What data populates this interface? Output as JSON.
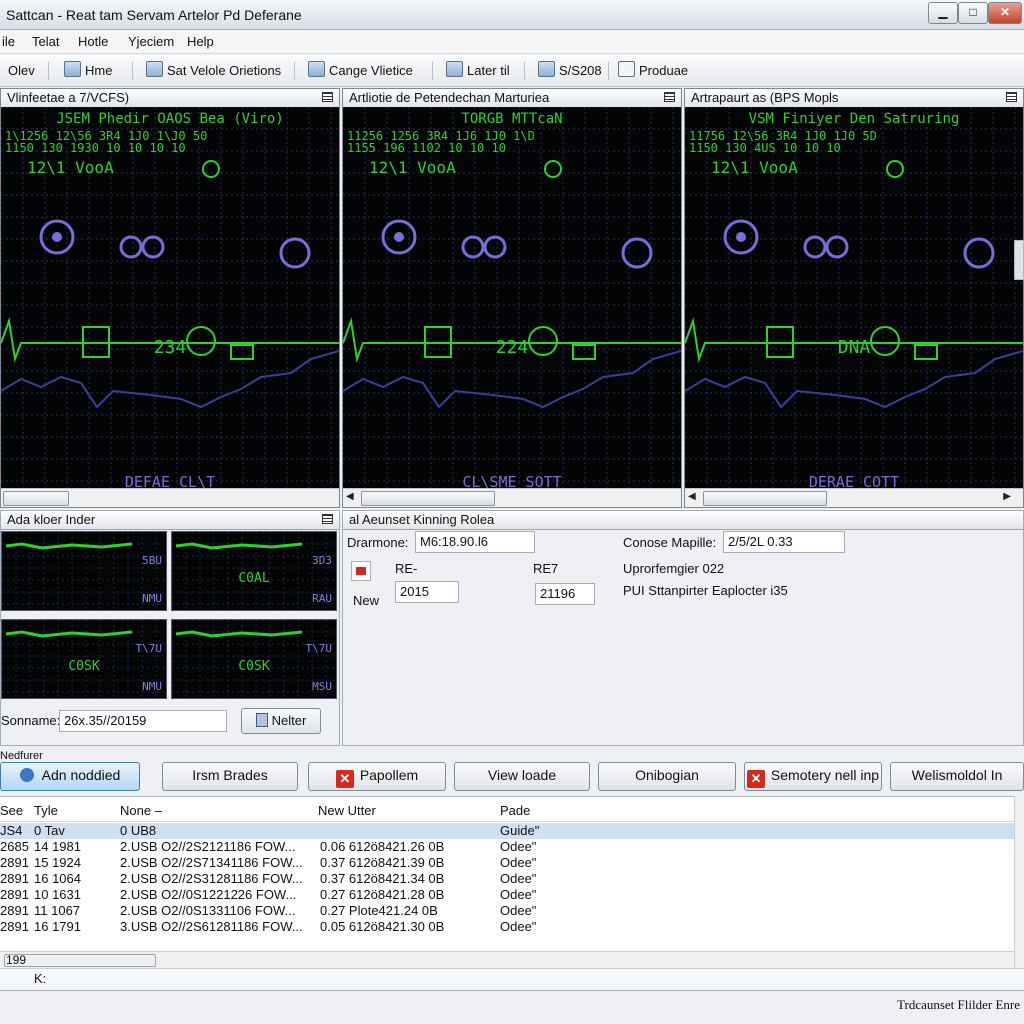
{
  "window": {
    "title": "Sattcan - Reat tam Servam Artelor Pd Deferane",
    "min": "▁",
    "max": "□",
    "close": "✕"
  },
  "menu": [
    "ile",
    "Telat",
    "Hotle",
    "Yjeciem",
    "Help"
  ],
  "toolbar": {
    "items": [
      "Olev",
      "Hme",
      "Sat Velole Orietions",
      "Cange Vlietice",
      "Later til",
      "S/S208",
      "Produae"
    ]
  },
  "panels": [
    {
      "title": "Vlinfeetae a 7/VCFS)",
      "scope_title": "JSEM Phedir OAOS Bea (Viro)",
      "ticks_top": "1\\1256  12\\56  3R4  1J0  1\\J0  50",
      "ticks_bottom": "1150  130  1930  10  10  10  10",
      "tag": "12\\1 VooA",
      "mid": "234",
      "foot": "DEFAE CL\\T"
    },
    {
      "title": "Artliotie de Petendechan Marturiea",
      "scope_title": "TORGB MTTcaN",
      "ticks_top": "11256  1256  3R4  1J6  1J0  1\\D",
      "ticks_bottom": "1155  196  1102  10  10  10",
      "tag": "12\\1 VooA",
      "mid": "224",
      "foot": "CL\\SME SOTT"
    },
    {
      "title": "Artrapaurt as (BPS Mopls",
      "scope_title": "VSM Finiyer Den Satruring",
      "ticks_top": "11756  12\\56  3R4  1J0  1J0  5D",
      "ticks_bottom": "1150  130  4US  10  10  10",
      "tag": "12\\1 VooA",
      "mid": "DNA",
      "foot": "DERAE COTT"
    }
  ],
  "lower_left": {
    "title": "Ada kloer Inder",
    "cells": [
      {
        "big": "",
        "small": [
          "5BU",
          "NMU"
        ]
      },
      {
        "big": "C0AL",
        "small": [
          "3D3",
          "RAU"
        ]
      },
      {
        "big": "C0SK",
        "small": [
          "T\\7U",
          "NMU"
        ]
      },
      {
        "big": "C0SK",
        "small": [
          "T\\7U",
          "MSU"
        ]
      }
    ],
    "sonname_label": "Sonname:",
    "sonname_value": "26x.35//20159",
    "button": "Nelter"
  },
  "lower_right": {
    "title": "al Aeunset Kinning Rolea",
    "dramone_label": "Drarmone:",
    "dramone_value": "M6:18.90.l6",
    "conose_label": "Conose Mapille:",
    "conose_value": "2/5/2L 0.33",
    "re_label": "RE-",
    "re7_label": "RE7",
    "new_label": "New",
    "new_value": "2015",
    "re7_value": "21196",
    "uprorr": "Uprorfemgier 022",
    "pui": "PUI Sttanpirter Eaplocter i35"
  },
  "section_label": "Nedfurer",
  "buttons": [
    "Adn noddied",
    "Irsm Brades",
    "Papollem",
    "View loade",
    "Onibogian",
    "Semotery nell inp",
    "Welismoldol In"
  ],
  "table": {
    "headers": [
      "See",
      "Tyle",
      "Nonе –",
      "New Utter",
      "Pade"
    ],
    "rows": [
      [
        "JS4",
        "0 Tav",
        "0 UB8",
        "",
        "Guide\""
      ],
      [
        "2685",
        "14 1981",
        "2.USB O2//2S2121186 FOW...",
        "0.06 612ö8421.26 0B",
        "Odee\""
      ],
      [
        "2891",
        "15 1924",
        "2.USB O2//2S71341186 FOW...",
        "0.37 612ö8421.39 0B",
        "Odee\""
      ],
      [
        "2891",
        "16 1064",
        "2.USB O2//2S31281186 FOW...",
        "0.37 612ö8421.34 0B",
        "Odee\""
      ],
      [
        "2891",
        "10 1631",
        "2.USB O2//0S1221226 FOW...",
        "0.27 612ö8421.28 0B",
        "Odee\""
      ],
      [
        "2891",
        "11 1067",
        "2.USB O2//0S1331106 FOW...",
        "0.27 Plote421.24 0B",
        "Odee\""
      ],
      [
        "2891",
        "16 1791",
        "3.USB O2//2S61281186 FOW...",
        "0.05 612ö8421.30 0B",
        "Odee\""
      ],
      [
        "",
        "",
        "",
        "",
        ""
      ]
    ],
    "scroll_left": "199",
    "footer": "K:"
  },
  "status": "Trdcaunset Flilder Enre",
  "colors": {
    "trace": "#2fd12f",
    "grid": "#2a2a6a",
    "purple": "#7a6cd9"
  }
}
